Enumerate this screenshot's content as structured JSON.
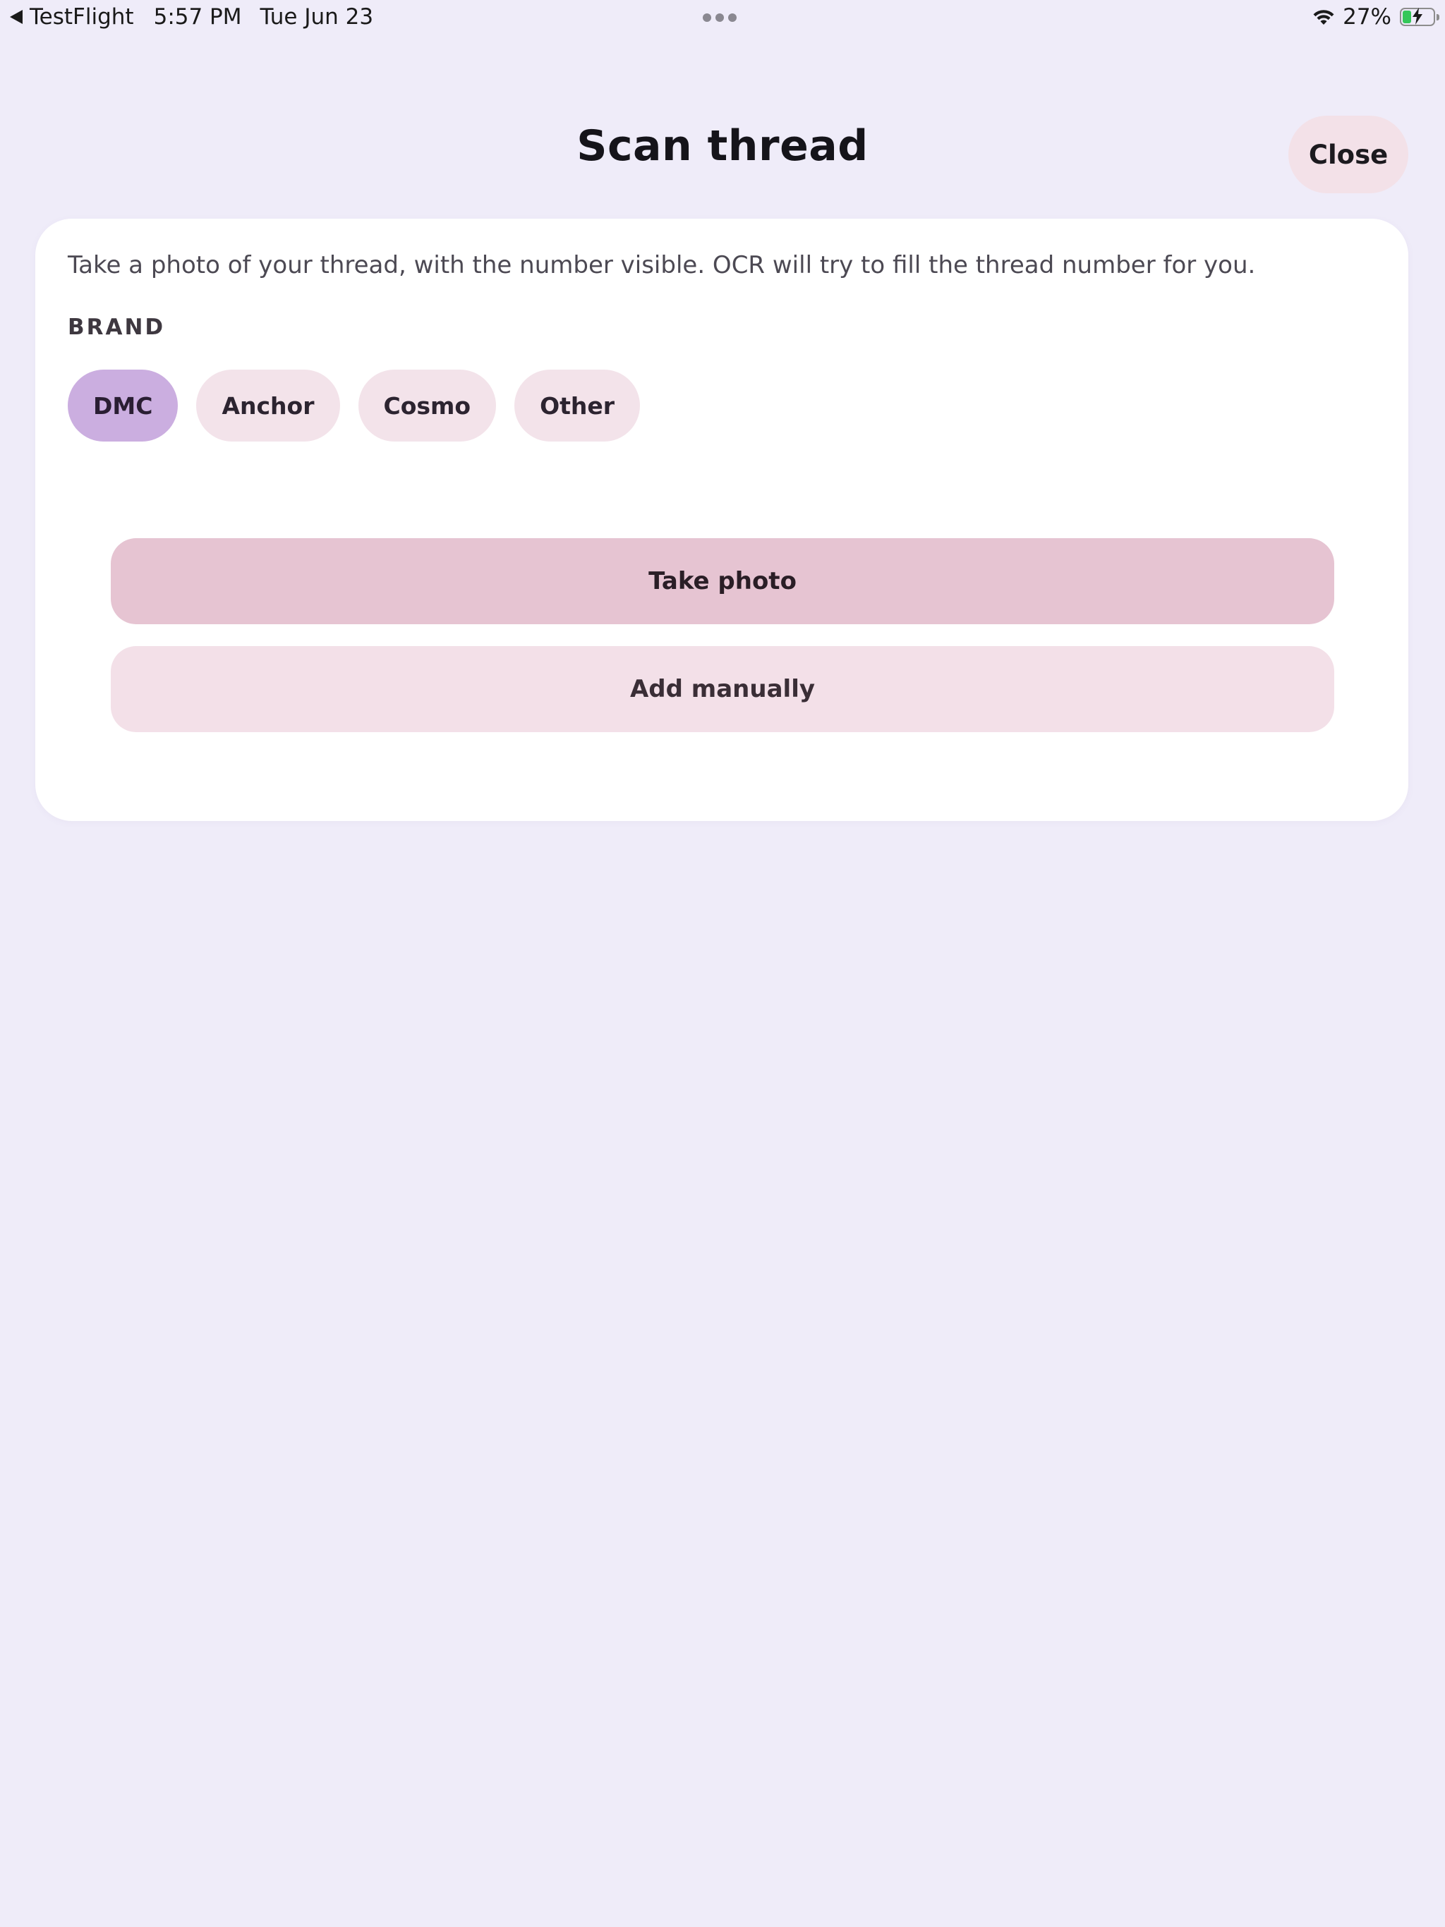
{
  "status_bar": {
    "back_app": "TestFlight",
    "time": "5:57 PM",
    "date": "Tue Jun 23",
    "battery_percent": "27%",
    "battery_level": 0.27
  },
  "header": {
    "title": "Scan thread",
    "close_label": "Close"
  },
  "card": {
    "intro": "Take a photo of your thread, with the number visible. OCR will try to fill the thread number for you.",
    "brand_label": "BRAND",
    "brands": [
      {
        "label": "DMC",
        "selected": true
      },
      {
        "label": "Anchor",
        "selected": false
      },
      {
        "label": "Cosmo",
        "selected": false
      },
      {
        "label": "Other",
        "selected": false
      }
    ],
    "take_photo_label": "Take photo",
    "add_manually_label": "Add manually"
  },
  "colors": {
    "background": "#efecf9",
    "card": "#ffffff",
    "chip": "#f3e3ea",
    "chip_selected": "#cbaee0",
    "primary_button": "#e6c4d2",
    "secondary_button": "#f3e0e8",
    "battery_fill": "#34c759"
  },
  "icons": {
    "back": "back-arrow-icon",
    "multitask": "multitask-dots-icon",
    "wifi": "wifi-icon",
    "battery": "battery-charging-icon"
  }
}
